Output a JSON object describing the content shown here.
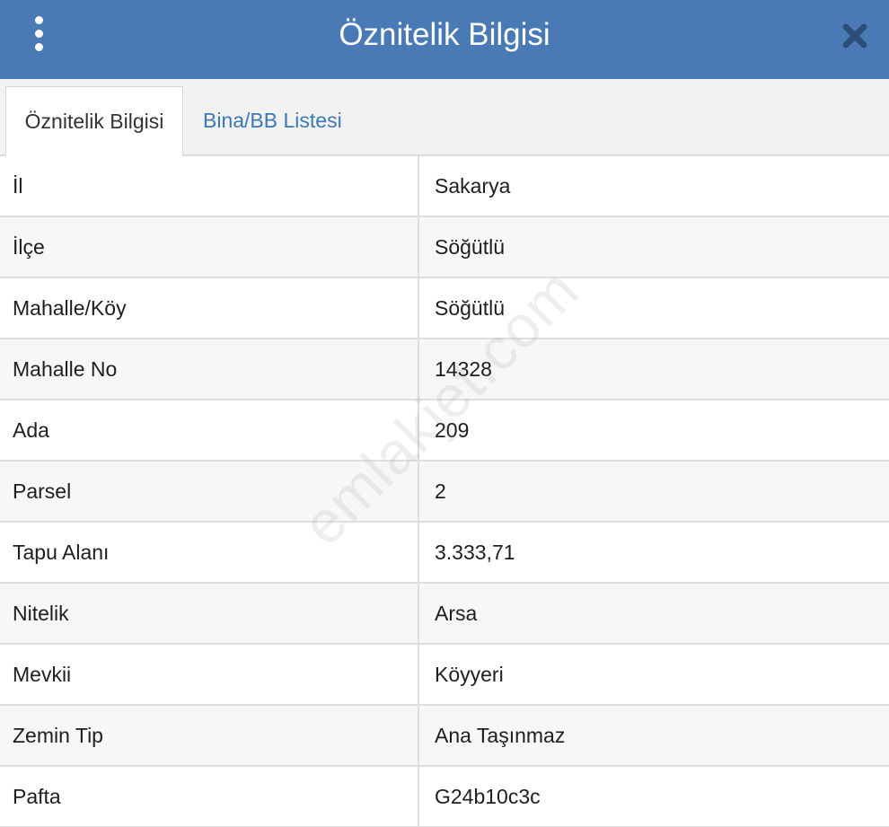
{
  "header": {
    "title": "Öznitelik Bilgisi",
    "menu_icon": "vertical-ellipsis-icon",
    "close_icon": "close-icon"
  },
  "tabs": [
    {
      "label": "Öznitelik Bilgisi",
      "active": true
    },
    {
      "label": "Bina/BB Listesi",
      "active": false
    }
  ],
  "rows": [
    {
      "key": "İl",
      "value": "Sakarya"
    },
    {
      "key": "İlçe",
      "value": "Söğütlü"
    },
    {
      "key": "Mahalle/Köy",
      "value": "Söğütlü"
    },
    {
      "key": "Mahalle No",
      "value": "14328"
    },
    {
      "key": "Ada",
      "value": "209"
    },
    {
      "key": "Parsel",
      "value": "2"
    },
    {
      "key": "Tapu Alanı",
      "value": "3.333,71"
    },
    {
      "key": "Nitelik",
      "value": "Arsa"
    },
    {
      "key": "Mevkii",
      "value": "Köyyeri"
    },
    {
      "key": "Zemin Tip",
      "value": "Ana Taşınmaz"
    },
    {
      "key": "Pafta",
      "value": "G24b10c3c"
    }
  ],
  "watermark": "emlakjet.com",
  "colors": {
    "header_bg": "#4a7ab5",
    "tab_link": "#3b78b4",
    "row_alt_bg": "#f7f7f7"
  }
}
